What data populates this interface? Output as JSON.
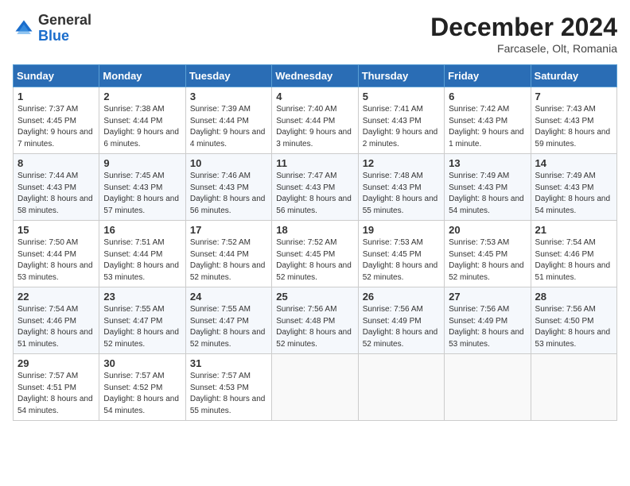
{
  "header": {
    "logo_general": "General",
    "logo_blue": "Blue",
    "month_title": "December 2024",
    "location": "Farcasele, Olt, Romania"
  },
  "weekdays": [
    "Sunday",
    "Monday",
    "Tuesday",
    "Wednesday",
    "Thursday",
    "Friday",
    "Saturday"
  ],
  "weeks": [
    [
      {
        "day": "1",
        "sunrise": "7:37 AM",
        "sunset": "4:45 PM",
        "daylight": "9 hours and 7 minutes."
      },
      {
        "day": "2",
        "sunrise": "7:38 AM",
        "sunset": "4:44 PM",
        "daylight": "9 hours and 6 minutes."
      },
      {
        "day": "3",
        "sunrise": "7:39 AM",
        "sunset": "4:44 PM",
        "daylight": "9 hours and 4 minutes."
      },
      {
        "day": "4",
        "sunrise": "7:40 AM",
        "sunset": "4:44 PM",
        "daylight": "9 hours and 3 minutes."
      },
      {
        "day": "5",
        "sunrise": "7:41 AM",
        "sunset": "4:43 PM",
        "daylight": "9 hours and 2 minutes."
      },
      {
        "day": "6",
        "sunrise": "7:42 AM",
        "sunset": "4:43 PM",
        "daylight": "9 hours and 1 minute."
      },
      {
        "day": "7",
        "sunrise": "7:43 AM",
        "sunset": "4:43 PM",
        "daylight": "8 hours and 59 minutes."
      }
    ],
    [
      {
        "day": "8",
        "sunrise": "7:44 AM",
        "sunset": "4:43 PM",
        "daylight": "8 hours and 58 minutes."
      },
      {
        "day": "9",
        "sunrise": "7:45 AM",
        "sunset": "4:43 PM",
        "daylight": "8 hours and 57 minutes."
      },
      {
        "day": "10",
        "sunrise": "7:46 AM",
        "sunset": "4:43 PM",
        "daylight": "8 hours and 56 minutes."
      },
      {
        "day": "11",
        "sunrise": "7:47 AM",
        "sunset": "4:43 PM",
        "daylight": "8 hours and 56 minutes."
      },
      {
        "day": "12",
        "sunrise": "7:48 AM",
        "sunset": "4:43 PM",
        "daylight": "8 hours and 55 minutes."
      },
      {
        "day": "13",
        "sunrise": "7:49 AM",
        "sunset": "4:43 PM",
        "daylight": "8 hours and 54 minutes."
      },
      {
        "day": "14",
        "sunrise": "7:49 AM",
        "sunset": "4:43 PM",
        "daylight": "8 hours and 54 minutes."
      }
    ],
    [
      {
        "day": "15",
        "sunrise": "7:50 AM",
        "sunset": "4:44 PM",
        "daylight": "8 hours and 53 minutes."
      },
      {
        "day": "16",
        "sunrise": "7:51 AM",
        "sunset": "4:44 PM",
        "daylight": "8 hours and 53 minutes."
      },
      {
        "day": "17",
        "sunrise": "7:52 AM",
        "sunset": "4:44 PM",
        "daylight": "8 hours and 52 minutes."
      },
      {
        "day": "18",
        "sunrise": "7:52 AM",
        "sunset": "4:45 PM",
        "daylight": "8 hours and 52 minutes."
      },
      {
        "day": "19",
        "sunrise": "7:53 AM",
        "sunset": "4:45 PM",
        "daylight": "8 hours and 52 minutes."
      },
      {
        "day": "20",
        "sunrise": "7:53 AM",
        "sunset": "4:45 PM",
        "daylight": "8 hours and 52 minutes."
      },
      {
        "day": "21",
        "sunrise": "7:54 AM",
        "sunset": "4:46 PM",
        "daylight": "8 hours and 51 minutes."
      }
    ],
    [
      {
        "day": "22",
        "sunrise": "7:54 AM",
        "sunset": "4:46 PM",
        "daylight": "8 hours and 51 minutes."
      },
      {
        "day": "23",
        "sunrise": "7:55 AM",
        "sunset": "4:47 PM",
        "daylight": "8 hours and 52 minutes."
      },
      {
        "day": "24",
        "sunrise": "7:55 AM",
        "sunset": "4:47 PM",
        "daylight": "8 hours and 52 minutes."
      },
      {
        "day": "25",
        "sunrise": "7:56 AM",
        "sunset": "4:48 PM",
        "daylight": "8 hours and 52 minutes."
      },
      {
        "day": "26",
        "sunrise": "7:56 AM",
        "sunset": "4:49 PM",
        "daylight": "8 hours and 52 minutes."
      },
      {
        "day": "27",
        "sunrise": "7:56 AM",
        "sunset": "4:49 PM",
        "daylight": "8 hours and 53 minutes."
      },
      {
        "day": "28",
        "sunrise": "7:56 AM",
        "sunset": "4:50 PM",
        "daylight": "8 hours and 53 minutes."
      }
    ],
    [
      {
        "day": "29",
        "sunrise": "7:57 AM",
        "sunset": "4:51 PM",
        "daylight": "8 hours and 54 minutes."
      },
      {
        "day": "30",
        "sunrise": "7:57 AM",
        "sunset": "4:52 PM",
        "daylight": "8 hours and 54 minutes."
      },
      {
        "day": "31",
        "sunrise": "7:57 AM",
        "sunset": "4:53 PM",
        "daylight": "8 hours and 55 minutes."
      },
      null,
      null,
      null,
      null
    ]
  ],
  "labels": {
    "sunrise": "Sunrise:",
    "sunset": "Sunset:",
    "daylight": "Daylight:"
  }
}
